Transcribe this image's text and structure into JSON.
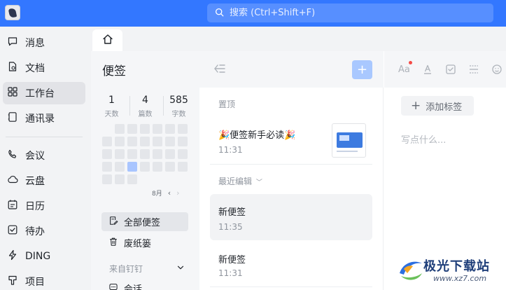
{
  "search": {
    "placeholder": "搜索 (Ctrl+Shift+F)"
  },
  "nav": {
    "items": [
      {
        "label": "消息",
        "icon": "chat-bubble-icon"
      },
      {
        "label": "文档",
        "icon": "document-icon"
      },
      {
        "label": "工作台",
        "icon": "grid-icon",
        "active": true
      },
      {
        "label": "通讯录",
        "icon": "contacts-icon"
      },
      {
        "label": "会议",
        "icon": "phone-icon"
      },
      {
        "label": "云盘",
        "icon": "cloud-icon"
      },
      {
        "label": "日历",
        "icon": "calendar-icon"
      },
      {
        "label": "待办",
        "icon": "todo-check-icon"
      },
      {
        "label": "DING",
        "icon": "lightning-icon"
      },
      {
        "label": "项目",
        "icon": "pin-icon"
      }
    ]
  },
  "tabs": {
    "home_icon": "home-icon"
  },
  "notes_side": {
    "title": "便签",
    "stats": [
      {
        "value": "1",
        "label": "天数"
      },
      {
        "value": "4",
        "label": "篇数"
      },
      {
        "value": "585",
        "label": "字数"
      }
    ],
    "month_label": "8月",
    "items": [
      {
        "label": "全部便签",
        "icon": "note-edit-icon",
        "active": true
      },
      {
        "label": "废纸篓",
        "icon": "trash-icon"
      }
    ],
    "group": {
      "label": "来自钉钉"
    },
    "partial_item": "会话"
  },
  "notes_list": {
    "pinned_label": "置顶",
    "pinned": {
      "title": "🎉便签新手必读🎉",
      "time": "11:31"
    },
    "recent_label": "最近编辑",
    "notes": [
      {
        "title": "新便签",
        "time": "11:35",
        "active": true
      },
      {
        "title": "新便签",
        "time": "11:31"
      }
    ]
  },
  "editor": {
    "add_tag_label": "添加标签",
    "placeholder": "写点什么..."
  },
  "watermark": {
    "name": "极光下载站",
    "url": "www.xz7.com"
  },
  "colors": {
    "topbar": "#3377ff",
    "accent_light": "#a9c8ff",
    "notify_dot": "#f54a45"
  }
}
